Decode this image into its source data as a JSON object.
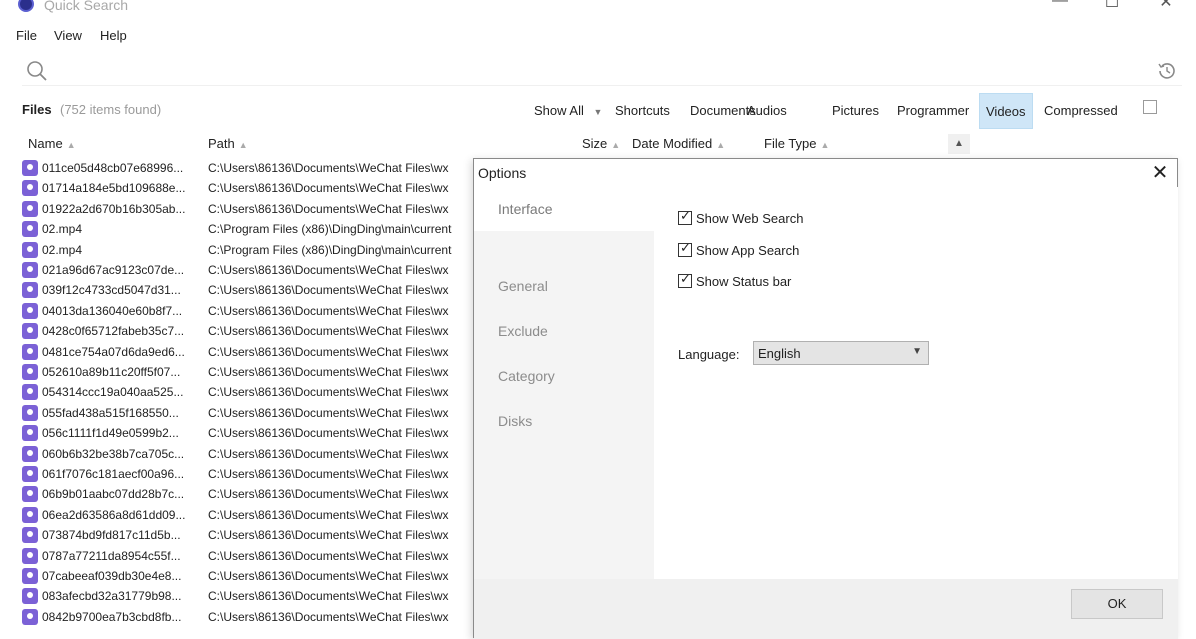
{
  "window": {
    "title": "Quick Search",
    "controls": [
      "—",
      "☐",
      "✕"
    ]
  },
  "menu": {
    "items": [
      "File",
      "View",
      "Help"
    ]
  },
  "search": {
    "placeholder": "",
    "value": ""
  },
  "results": {
    "label": "Files",
    "count": "(752 items found)"
  },
  "categories": {
    "show_all": "Show All",
    "items": [
      "Shortcuts",
      "Documents",
      "Audios",
      "Pictures",
      "Programmer",
      "Videos",
      "Compressed"
    ],
    "active": "Videos"
  },
  "table": {
    "columns": [
      "Name",
      "Path",
      "Size",
      "Date Modified",
      "File Type"
    ],
    "rows": [
      {
        "name": "011ce05d48cb07e68996...",
        "path": "C:\\Users\\86136\\Documents\\WeChat Files\\wx"
      },
      {
        "name": "01714a184e5bd109688e...",
        "path": "C:\\Users\\86136\\Documents\\WeChat Files\\wx"
      },
      {
        "name": "01922a2d670b16b305ab...",
        "path": "C:\\Users\\86136\\Documents\\WeChat Files\\wx"
      },
      {
        "name": "02.mp4",
        "path": "C:\\Program Files (x86)\\DingDing\\main\\current"
      },
      {
        "name": "02.mp4",
        "path": "C:\\Program Files (x86)\\DingDing\\main\\current"
      },
      {
        "name": "021a96d67ac9123c07de...",
        "path": "C:\\Users\\86136\\Documents\\WeChat Files\\wx"
      },
      {
        "name": "039f12c4733cd5047d31...",
        "path": "C:\\Users\\86136\\Documents\\WeChat Files\\wx"
      },
      {
        "name": "04013da136040e60b8f7...",
        "path": "C:\\Users\\86136\\Documents\\WeChat Files\\wx"
      },
      {
        "name": "0428c0f65712fabeb35c7...",
        "path": "C:\\Users\\86136\\Documents\\WeChat Files\\wx"
      },
      {
        "name": "0481ce754a07d6da9ed6...",
        "path": "C:\\Users\\86136\\Documents\\WeChat Files\\wx"
      },
      {
        "name": "052610a89b11c20ff5f07...",
        "path": "C:\\Users\\86136\\Documents\\WeChat Files\\wx"
      },
      {
        "name": "054314ccc19a040aa525...",
        "path": "C:\\Users\\86136\\Documents\\WeChat Files\\wx"
      },
      {
        "name": "055fad438a515f168550...",
        "path": "C:\\Users\\86136\\Documents\\WeChat Files\\wx"
      },
      {
        "name": "056c1111f1d49e0599b2...",
        "path": "C:\\Users\\86136\\Documents\\WeChat Files\\wx"
      },
      {
        "name": "060b6b32be38b7ca705c...",
        "path": "C:\\Users\\86136\\Documents\\WeChat Files\\wx"
      },
      {
        "name": "061f7076c181aecf00a96...",
        "path": "C:\\Users\\86136\\Documents\\WeChat Files\\wx"
      },
      {
        "name": "06b9b01aabc07dd28b7c...",
        "path": "C:\\Users\\86136\\Documents\\WeChat Files\\wx"
      },
      {
        "name": "06ea2d63586a8d61dd09...",
        "path": "C:\\Users\\86136\\Documents\\WeChat Files\\wx"
      },
      {
        "name": "073874bd9fd817c11d5b...",
        "path": "C:\\Users\\86136\\Documents\\WeChat Files\\wx"
      },
      {
        "name": "0787a77211da8954c55f...",
        "path": "C:\\Users\\86136\\Documents\\WeChat Files\\wx"
      },
      {
        "name": "07cabeeaf039db30e4e8...",
        "path": "C:\\Users\\86136\\Documents\\WeChat Files\\wx"
      },
      {
        "name": "083afecbd32a31779b98...",
        "path": "C:\\Users\\86136\\Documents\\WeChat Files\\wx"
      },
      {
        "name": "0842b9700ea7b3cbd8fb...",
        "path": "C:\\Users\\86136\\Documents\\WeChat Files\\wx"
      }
    ]
  },
  "options_dialog": {
    "title": "Options",
    "close": "✕",
    "nav": [
      "Interface",
      "General",
      "Exclude",
      "Category",
      "Disks"
    ],
    "active_nav": "Interface",
    "checkboxes": [
      {
        "label": "Show Web Search",
        "checked": true
      },
      {
        "label": "Show App Search",
        "checked": true
      },
      {
        "label": "Show Status bar",
        "checked": true
      }
    ],
    "language_label": "Language:",
    "language_value": "English",
    "ok_label": "OK"
  },
  "colors": {
    "accent": "#cfe6f7",
    "file_icon": "#7b61d6",
    "nav_bg": "#f4f4f4"
  }
}
